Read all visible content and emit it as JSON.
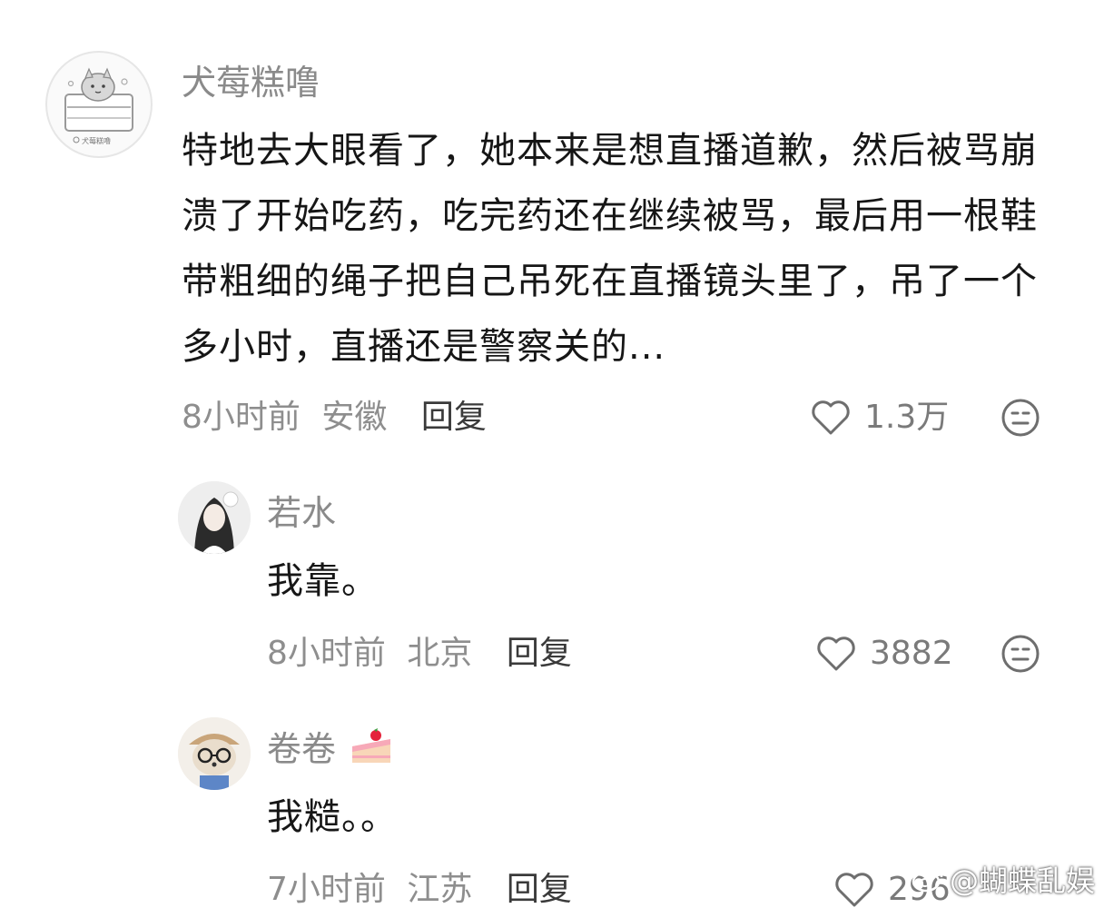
{
  "comments": [
    {
      "username": "犬莓糕噜",
      "avatar_text": "犬莓糕噜",
      "text": "特地去大眼看了，她本来是想直播道歉，然后被骂崩溃了开始吃药，吃完药还在继续被骂，最后用一根鞋带粗细的绳子把自己吊死在直播镜头里了，吊了一个多小时，直播还是警察关的...",
      "time": "8小时前",
      "location": "安徽",
      "reply_label": "回复",
      "likes": "1.3万"
    },
    {
      "username": "若水",
      "text": "我靠。",
      "time": "8小时前",
      "location": "北京",
      "reply_label": "回复",
      "likes": "3882"
    },
    {
      "username": "卷卷",
      "text": "我糙。。",
      "time": "7小时前",
      "location": "江苏",
      "reply_label": "回复",
      "likes": "296"
    }
  ],
  "watermark": "@蝴蝶乱娱",
  "icons": {
    "like": "heart-outline-icon",
    "dislike": "neutral-face-icon",
    "badge": "strawberry-cake-icon"
  },
  "colors": {
    "username": "#8a8a8a",
    "body_text": "#161616",
    "meta": "#8e8e8e",
    "reply": "#3a3a3a"
  }
}
